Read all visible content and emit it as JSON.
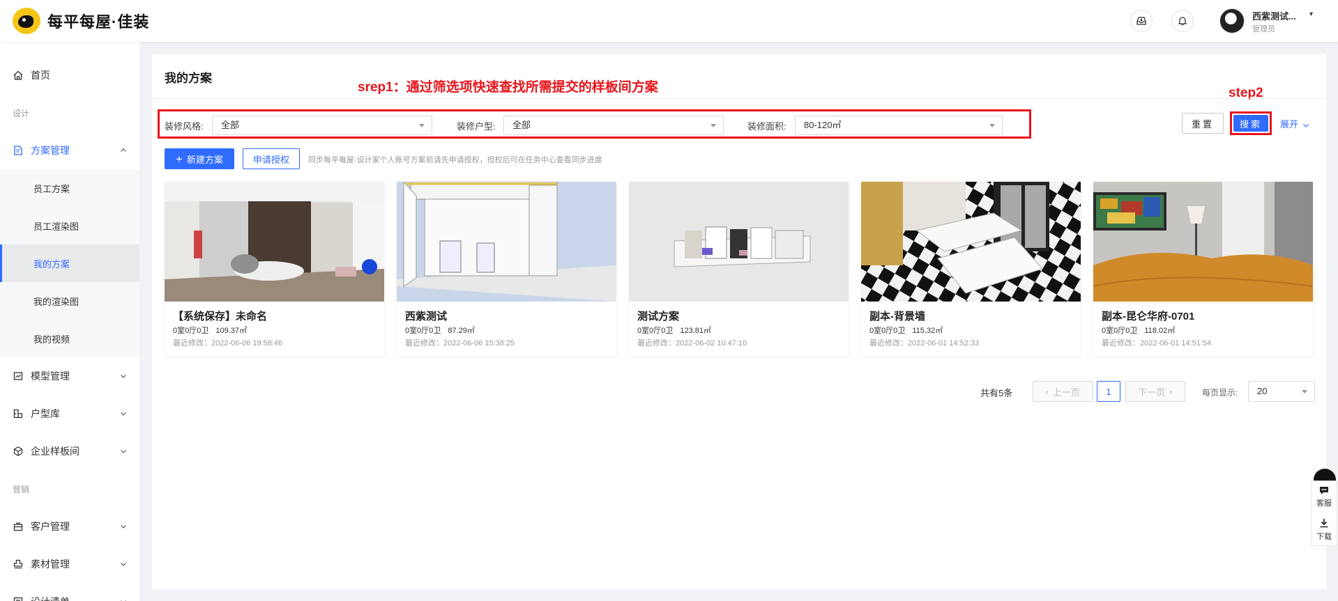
{
  "header": {
    "logo_text": "每平每屋·佳装",
    "user_name": "西紫测试...",
    "user_role": "管理员"
  },
  "sidebar": {
    "home": "首页",
    "section_design": "设计",
    "plan_mgmt": "方案管理",
    "sub_items": [
      {
        "label": "员工方案"
      },
      {
        "label": "员工渲染图"
      },
      {
        "label": "我的方案"
      },
      {
        "label": "我的渲染图"
      },
      {
        "label": "我的视频"
      }
    ],
    "model_mgmt": "模型管理",
    "floorplan_lib": "户型库",
    "enterprise_showroom": "企业样板间",
    "section_marketing": "营销",
    "customer_mgmt": "客户管理",
    "material_mgmt": "素材管理",
    "design_list": "设计清单"
  },
  "main": {
    "title": "我的方案",
    "annotation_step1": "srep1：通过筛选项快速查找所需提交的样板间方案",
    "annotation_step2": "step2",
    "filters": {
      "style_label": "装修风格:",
      "style_value": "全部",
      "type_label": "装修户型:",
      "type_value": "全部",
      "area_label": "装修面积:",
      "area_value": "80-120㎡"
    },
    "reset_label": "重置",
    "search_label": "搜索",
    "expand_label": "展开",
    "new_plan_label": "新建方案",
    "apply_auth_label": "申请授权",
    "hint_text": "同步每平每屋·设计家个人账号方案前请先申请授权，授权后可在任务中心查看同步进度"
  },
  "cards": [
    {
      "title": "【系统保存】未命名",
      "rooms": "0室0厅0卫",
      "area": "109.37㎡",
      "modified": "最近修改：2022-06-06 19:58:46"
    },
    {
      "title": "西紫测试",
      "rooms": "0室0厅0卫",
      "area": "87.29㎡",
      "modified": "最近修改：2022-06-06 15:38:25"
    },
    {
      "title": "测试方案",
      "rooms": "0室0厅0卫",
      "area": "123.81㎡",
      "modified": "最近修改：2022-06-02 10:47:10"
    },
    {
      "title": "副本-背景墙",
      "rooms": "0室0厅0卫",
      "area": "115.32㎡",
      "modified": "最近修改：2022-06-01 14:52:33"
    },
    {
      "title": "副本-昆仑华府-0701",
      "rooms": "0室0厅0卫",
      "area": "118.02㎡",
      "modified": "最近修改：2022-06-01 14:51:54"
    }
  ],
  "pagination": {
    "total": "共有5条",
    "prev": "上一页",
    "current": "1",
    "next": "下一页",
    "per_page_label": "每页显示:",
    "per_page_value": "20"
  },
  "float_panel": {
    "service": "客服",
    "download": "下载"
  },
  "colors": {
    "accent": "#2f6bff",
    "annotation_red": "#e8141b"
  }
}
